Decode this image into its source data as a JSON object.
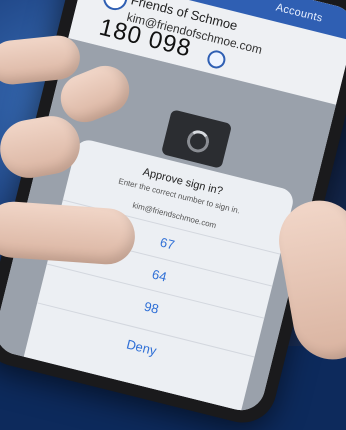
{
  "header": {
    "title": "Accounts"
  },
  "account": {
    "name": "Friends of Schmoe",
    "email": "kim@friendofschmoe.com",
    "code": "180 098"
  },
  "dialog": {
    "title": "Approve sign in?",
    "description": "Enter the correct number to sign in.",
    "email": "kim@friendschmoe.com",
    "options": [
      "67",
      "64",
      "98"
    ],
    "deny_label": "Deny"
  },
  "colors": {
    "accent": "#2f5fb3",
    "link": "#2f6fd6"
  }
}
